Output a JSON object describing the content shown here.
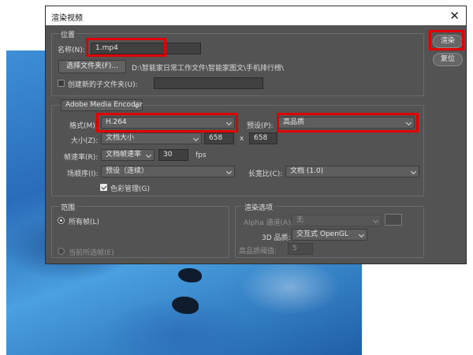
{
  "dialog": {
    "title": "渲染视频",
    "close_glyph": "✕"
  },
  "location": {
    "group_title": "位置",
    "name_label": "名称(N):",
    "name_value": "1.mp4",
    "choose_folder_button": "选择文件夹(F)...",
    "folder_path": "D:\\智能家日常工作文件\\智能家图文\\手机排行榜\\",
    "create_subfolder_label": "创建新的子文件夹(U):",
    "create_subfolder_checked": false,
    "subfolder_value": ""
  },
  "encoder": {
    "engine": "Adobe Media Encoder",
    "format_label": "格式(M):",
    "format_value": "H.264",
    "preset_label": "预设(P):",
    "preset_value": "高品质",
    "size_label": "大小(Z):",
    "size_value": "文档大小",
    "width": "658",
    "by": "x",
    "height": "658",
    "frame_rate_label": "帧速率(R):",
    "frame_rate_value": "文档帧速率",
    "fps_value": "30",
    "fps_unit": "fps",
    "field_order_label": "场顺序(I):",
    "field_order_value": "预设（连续）",
    "aspect_label": "长宽比(C):",
    "aspect_value": "文档 (1.0)",
    "color_manage_label": "色彩管理(G)",
    "color_manage_checked": true
  },
  "range": {
    "group_title": "范围",
    "all_frames_label": "所有帧(L)",
    "current_frame_label": "当前所选帧(E)",
    "selected": "all_frames"
  },
  "render_options": {
    "group_title": "渲染选项",
    "alpha_label": "Alpha 通道(A):",
    "alpha_value": "无",
    "quality_3d_label": "3D 品质:",
    "quality_3d_value": "交互式 OpenGL",
    "hq_threshold_label": "高品质阈值:",
    "hq_threshold_value": "5"
  },
  "actions": {
    "render_button": "渲染",
    "reset_button": "复位"
  },
  "colors": {
    "dialog_bg": "#535353",
    "highlight": "#e10000"
  }
}
